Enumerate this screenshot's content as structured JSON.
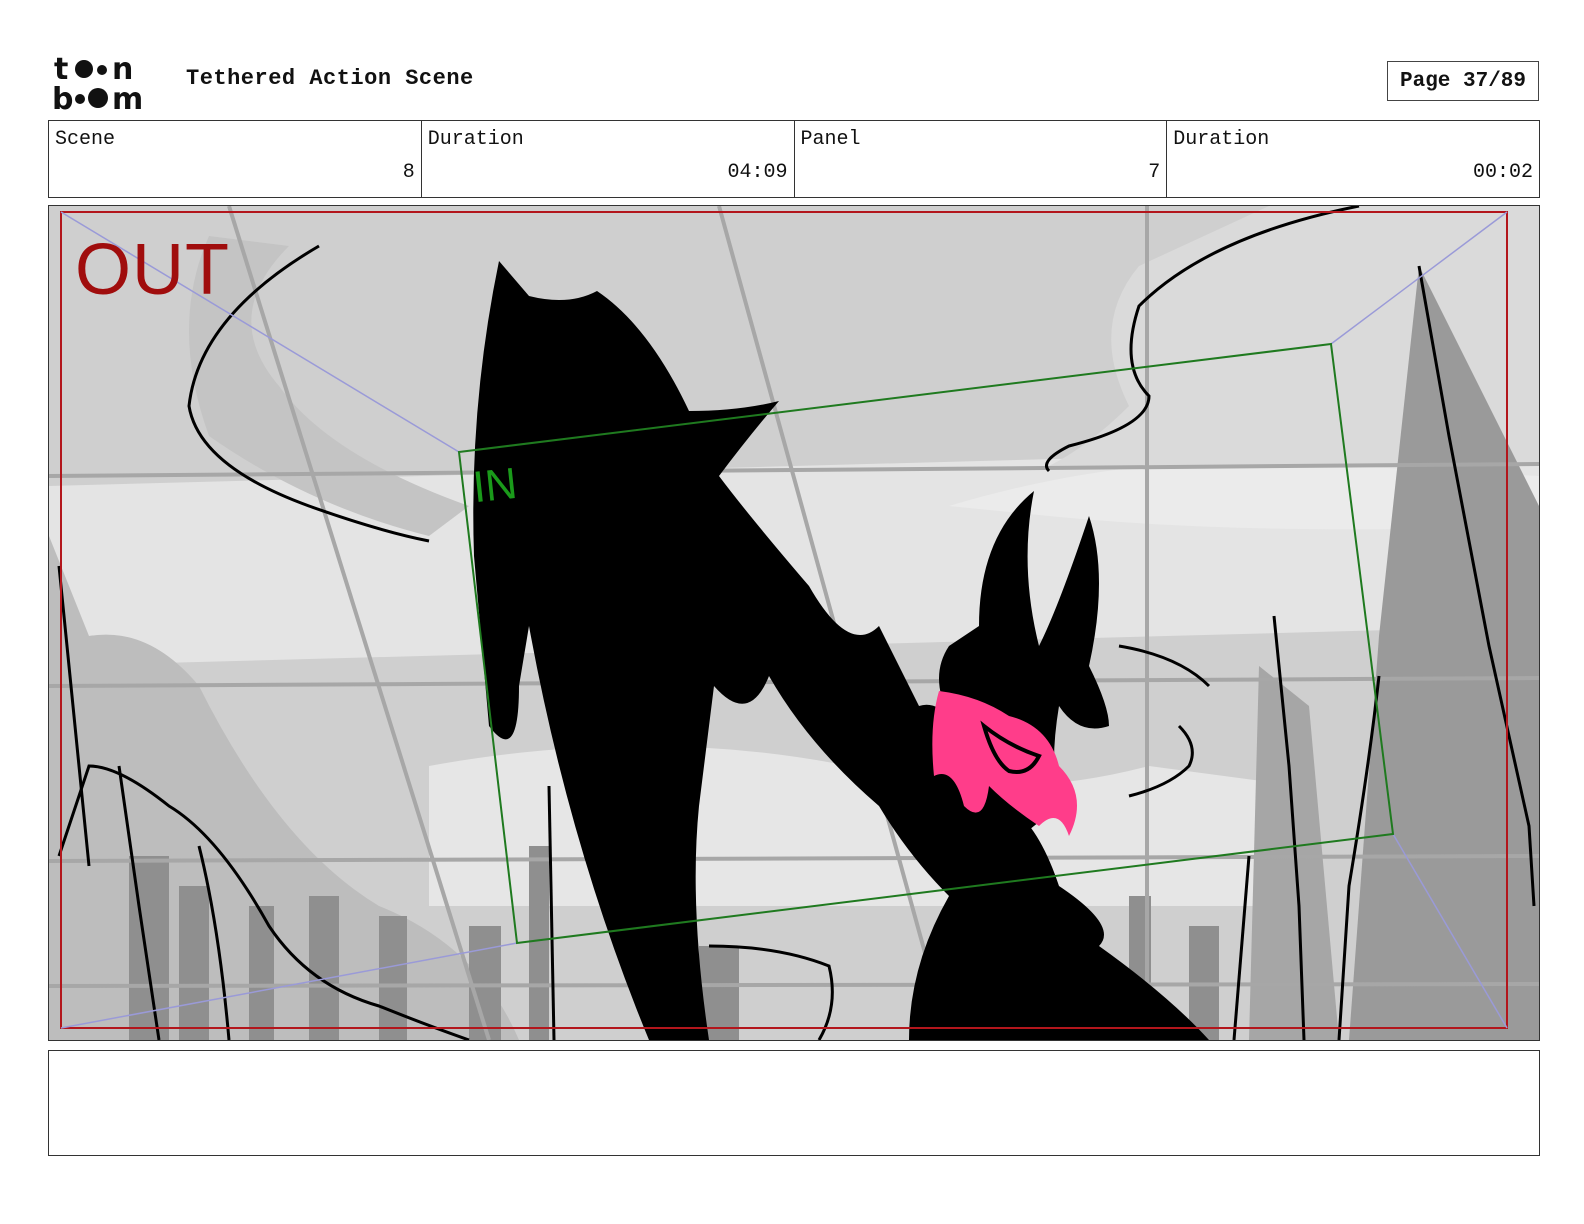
{
  "header": {
    "logo_text": "toon boom",
    "project_title": "Tethered Action Scene",
    "page_label": "Page 37/89"
  },
  "info": [
    {
      "label": "Scene",
      "value": "8"
    },
    {
      "label": "Duration",
      "value": "04:09"
    },
    {
      "label": "Panel",
      "value": "7"
    },
    {
      "label": "Duration",
      "value": "00:02"
    }
  ],
  "panel": {
    "out_label": "OUT",
    "in_label": "IN",
    "colors": {
      "out_frame": "#b3161c",
      "in_frame": "#1f7a1f",
      "guide_lines": "#9a9ad8",
      "accent": "#ff3d8a"
    }
  },
  "notes": {
    "text": ""
  }
}
